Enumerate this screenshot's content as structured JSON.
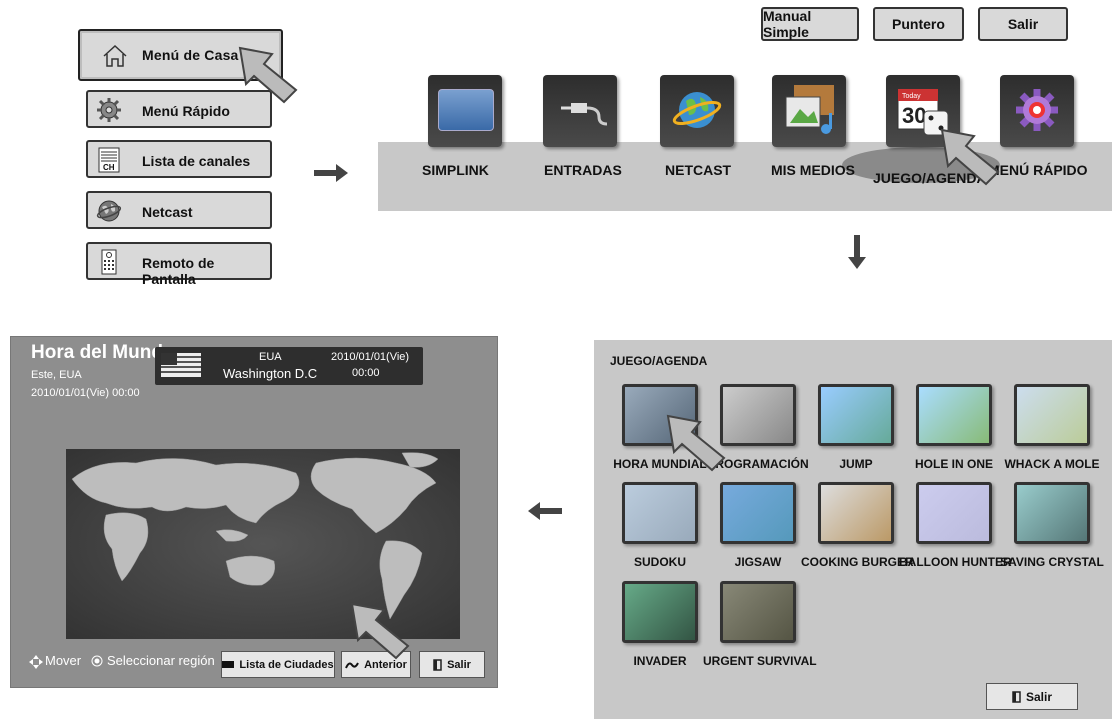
{
  "home_menu": {
    "home_label": "Menú de Casa",
    "items": [
      {
        "label": "Menú Rápido",
        "icon": "gear-icon"
      },
      {
        "label": "Lista de canales",
        "icon": "channel-list-icon",
        "icon_text": "CH"
      },
      {
        "label": "Netcast",
        "icon": "globe-icon"
      },
      {
        "label": "Remoto de Pantalla",
        "icon": "remote-icon"
      }
    ]
  },
  "top_buttons": [
    "Manual Simple",
    "Puntero",
    "Salir"
  ],
  "home_bar": {
    "items": [
      {
        "label": "SIMPLINK",
        "icon": "simplink-icon"
      },
      {
        "label": "ENTRADAS",
        "icon": "input-plug-icon"
      },
      {
        "label": "NETCAST",
        "icon": "globe-icon"
      },
      {
        "label": "MIS MEDIOS",
        "icon": "media-icon"
      },
      {
        "label": "JUEGO/AGENDA",
        "icon": "calendar-dice-icon",
        "icon_text_top": "Today",
        "icon_text": "30"
      },
      {
        "label": "MENÚ RÁPIDO",
        "icon": "gear-icon"
      }
    ]
  },
  "game_panel": {
    "title": "JUEGO/AGENDA",
    "tiles": [
      "HORA MUNDIAL",
      "PROGRAMACIÓN",
      "JUMP",
      "HOLE IN ONE",
      "WHACK A MOLE",
      "SUDOKU",
      "JIGSAW",
      "COOKING BURGER",
      "BALLOON HUNTER",
      "SAVING CRYSTAL",
      "INVADER",
      "URGENT SURVIVAL"
    ],
    "exit_label": "Salir"
  },
  "world_time": {
    "title": "Hora del Mundo",
    "region": "Este, EUA",
    "local_datetime": "2010/01/01(Vie) 00:00",
    "card": {
      "country": "EUA",
      "city": "Washington D.C",
      "date": "2010/01/01(Vie)",
      "time": "00:00"
    },
    "footer": {
      "move": "Mover",
      "select": "Seleccionar región",
      "city_list": "Lista de Ciudades",
      "back": "Anterior",
      "exit": "Salir"
    }
  },
  "colors": {
    "panel_gray": "#c8c8c8",
    "button_gray": "#d9d9d9",
    "world_time_bg": "#8e8e8e"
  }
}
